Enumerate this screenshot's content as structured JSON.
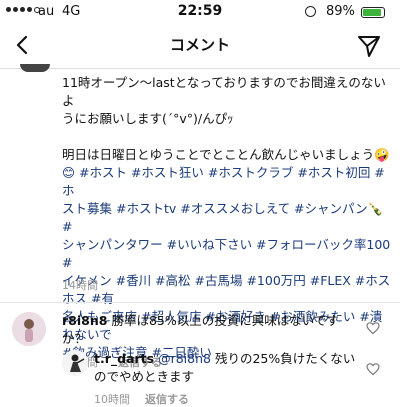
{
  "status_bar": {
    "carrier": "au",
    "network": "4G",
    "time": "22:59",
    "battery_percent": "89%",
    "battery_level": 0.89,
    "signal_bars": 4
  },
  "header": {
    "title": "コメント"
  },
  "post": {
    "line_1": "11時オープン〜lastとなっておりますのでお間違えのないよ",
    "line_2": "うにお願いします(´°v°)/んぴｯ",
    "line_3": "明日は日曜日とゆうことでとことん飲んじゃいましょう🤪",
    "line_4": "😊 #ホスト #ホスト狂い #ホストクラブ #ホスト初回 #ホ",
    "line_5": "スト募集 #ホストtv #オススメおしえて #シャンパン🍾 #",
    "line_6": "シャンパンタワー #いいね下さい #フォローバック率100 #",
    "line_7": "イケメン #香川 #高松 #古馬場 #100万円 #FLEX #ホスホス #有",
    "line_8": "名人もご来店 #超人気店 #お酒好き #お酒飲みたい #潰れないで",
    "line_9": "#飲み過ぎ注意 #二日酔い",
    "time": "14時間"
  },
  "comments": [
    {
      "username": "r8i8n8",
      "text_line_1": "勝率は85%以上の投資に興味はないです",
      "text_line_2": "か？",
      "time": "14時間",
      "reply_label": "返信する"
    },
    {
      "username": "t.r_darts",
      "mention": "@r8i8n8",
      "text_line_1": "残りの25%負けたくない",
      "text_line_2": "のでやめときます",
      "time": "10時間",
      "reply_label": "返信する"
    }
  ]
}
